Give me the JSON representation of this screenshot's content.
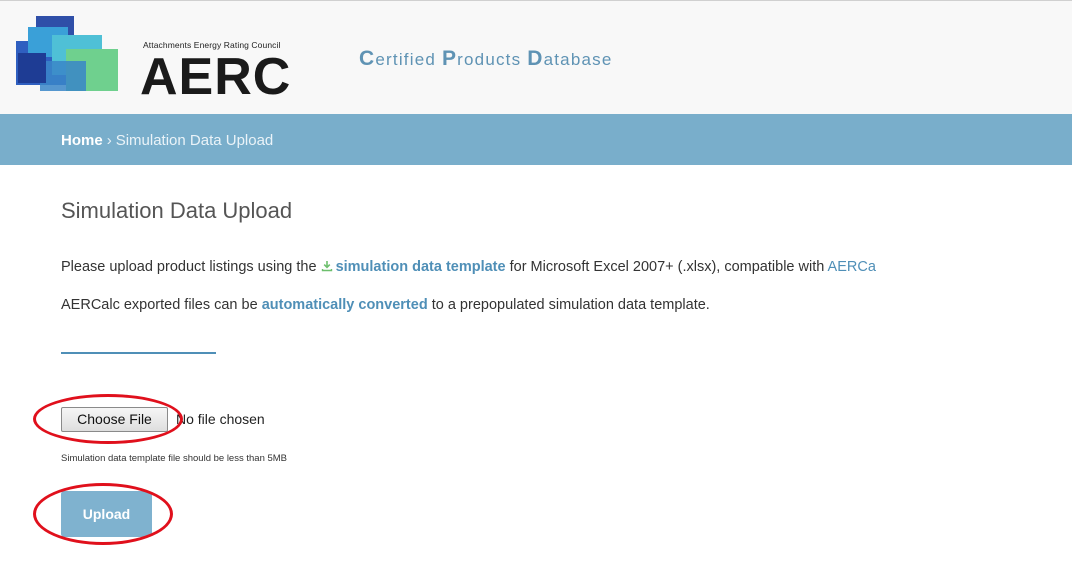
{
  "header": {
    "logo_small_text": "Attachments Energy Rating Council",
    "logo_text": "AERC",
    "db_title_parts": [
      "C",
      "ertified ",
      "P",
      "roducts ",
      "D",
      "atabase"
    ]
  },
  "breadcrumb": {
    "home": "Home",
    "separator": "›",
    "current": "Simulation Data Upload"
  },
  "page": {
    "title": "Simulation Data Upload",
    "p1_prefix": "Please upload product listings using the ",
    "p1_link": "simulation data template",
    "p1_suffix": " for Microsoft Excel 2007+ (.xlsx), compatible with ",
    "p1_cutoff_link": "AERCa",
    "p2_prefix": "AERCalc exported files can be ",
    "p2_link": "automatically converted",
    "p2_suffix": " to a prepopulated simulation data template."
  },
  "form": {
    "choose_label": "Choose File",
    "no_file_text": "No file chosen",
    "hint": "Simulation data template file should be less than 5MB",
    "upload_label": "Upload"
  },
  "icons": {
    "download": "download-icon",
    "logo": "aerc-logo-icon"
  },
  "colors": {
    "accent": "#4f8fb7",
    "breadcrumb_bar": "#79aecb",
    "upload_button": "#7fb2cf",
    "annotation": "#e0101c"
  }
}
